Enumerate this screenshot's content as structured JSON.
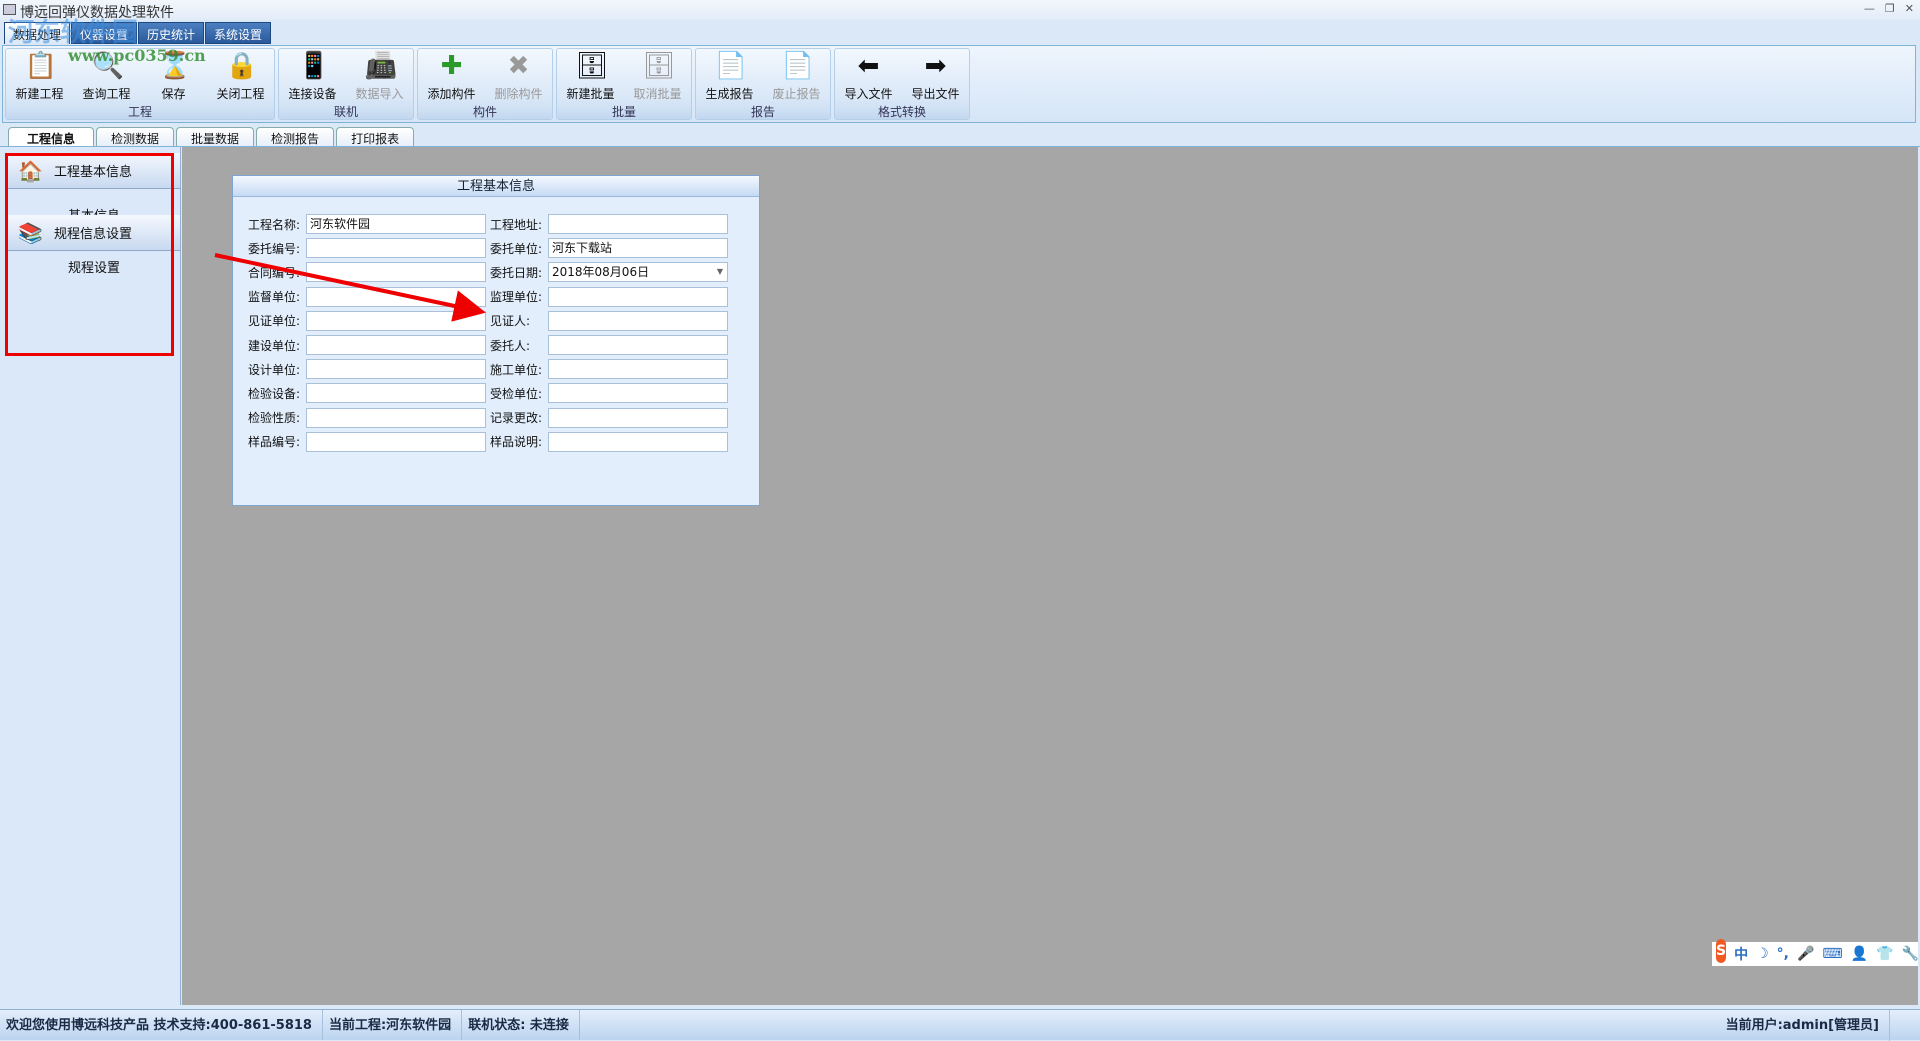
{
  "window": {
    "title": "博远回弹仪数据处理软件"
  },
  "watermark": {
    "text": "河东软件园",
    "url": "www.pc0359.cn"
  },
  "menu_tabs": [
    "数据处理",
    "仪器设置",
    "历史统计",
    "系统设置"
  ],
  "ribbon": [
    {
      "label": "工程",
      "buttons": [
        {
          "label": "新建工程",
          "icon": "new-project-icon",
          "enabled": true
        },
        {
          "label": "查询工程",
          "icon": "query-project-icon",
          "enabled": true
        },
        {
          "label": "保存",
          "icon": "save-icon",
          "enabled": true
        },
        {
          "label": "关闭工程",
          "icon": "close-project-icon",
          "enabled": true
        }
      ]
    },
    {
      "label": "联机",
      "buttons": [
        {
          "label": "连接设备",
          "icon": "connect-device-icon",
          "enabled": true
        },
        {
          "label": "数据导入",
          "icon": "data-import-icon",
          "enabled": false
        }
      ]
    },
    {
      "label": "构件",
      "buttons": [
        {
          "label": "添加构件",
          "icon": "plus-icon",
          "enabled": true
        },
        {
          "label": "删除构件",
          "icon": "x-icon",
          "enabled": false
        }
      ]
    },
    {
      "label": "批量",
      "buttons": [
        {
          "label": "新建批量",
          "icon": "database-add-icon",
          "enabled": true
        },
        {
          "label": "取消批量",
          "icon": "database-remove-icon",
          "enabled": false
        }
      ]
    },
    {
      "label": "报告",
      "buttons": [
        {
          "label": "生成报告",
          "icon": "report-add-icon",
          "enabled": true
        },
        {
          "label": "废止报告",
          "icon": "report-cancel-icon",
          "enabled": false
        }
      ]
    },
    {
      "label": "格式转换",
      "buttons": [
        {
          "label": "导入文件",
          "icon": "import-file-icon",
          "enabled": true
        },
        {
          "label": "导出文件",
          "icon": "export-file-icon",
          "enabled": true
        }
      ]
    }
  ],
  "doc_tabs": [
    "工程信息",
    "检测数据",
    "批量数据",
    "检测报告",
    "打印报表"
  ],
  "sidebar": [
    {
      "header": "工程基本信息",
      "icon": "house-icon",
      "item": "基本信息"
    },
    {
      "header": "规程信息设置",
      "icon": "books-icon",
      "item": "规程设置"
    }
  ],
  "form": {
    "title": "工程基本信息",
    "rows": [
      [
        {
          "label": "工程名称:",
          "value": "河东软件园"
        },
        {
          "label": "工程地址:",
          "value": ""
        }
      ],
      [
        {
          "label": "委托编号:",
          "value": ""
        },
        {
          "label": "委托单位:",
          "value": "河东下载站"
        }
      ],
      [
        {
          "label": "合同编号:",
          "value": ""
        },
        {
          "label": "委托日期:",
          "value": "2018年08月06日",
          "dropdown": true
        }
      ],
      [
        {
          "label": "监督单位:",
          "value": ""
        },
        {
          "label": "监理单位:",
          "value": ""
        }
      ],
      [
        {
          "label": "见证单位:",
          "value": ""
        },
        {
          "label": "见证人:",
          "value": ""
        }
      ],
      [
        {
          "label": "建设单位:",
          "value": ""
        },
        {
          "label": "委托人:",
          "value": ""
        }
      ],
      [
        {
          "label": "设计单位:",
          "value": ""
        },
        {
          "label": "施工单位:",
          "value": ""
        }
      ],
      [
        {
          "label": "检验设备:",
          "value": ""
        },
        {
          "label": "受检单位:",
          "value": ""
        }
      ],
      [
        {
          "label": "检验性质:",
          "value": ""
        },
        {
          "label": "记录更改:",
          "value": ""
        }
      ],
      [
        {
          "label": "样品编号:",
          "value": ""
        },
        {
          "label": "样品说明:",
          "value": ""
        }
      ]
    ]
  },
  "ime": {
    "items": [
      "中",
      "☽",
      "°,",
      "🎤",
      "⌨",
      "👤",
      "👕",
      "🔧"
    ]
  },
  "status": {
    "welcome": "欢迎您使用博远科技产品 技术支持:400-861-5818",
    "project": "当前工程:河东软件园",
    "connection": "联机状态: 未连接",
    "user": "当前用户:admin[管理员]"
  },
  "colors": {
    "annotation": "#e00000",
    "workspace": "#a6a6a6",
    "panel": "#dbe8f9"
  }
}
